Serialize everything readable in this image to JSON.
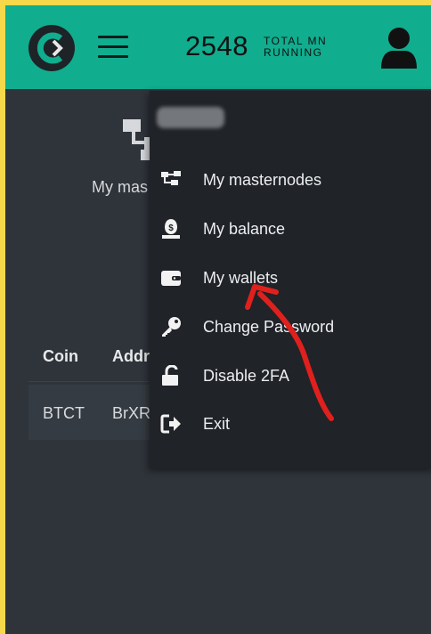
{
  "header": {
    "count": "2548",
    "count_label_line1": "TOTAL MN",
    "count_label_line2": "RUNNING",
    "logo_icon": "app-logo-icon",
    "menu_icon": "hamburger-icon",
    "account_icon": "user-icon"
  },
  "background": {
    "page_title": "My mas",
    "table": {
      "headers": [
        "Coin",
        "Addr"
      ],
      "rows": [
        [
          "BTCT",
          "BrXR"
        ]
      ]
    }
  },
  "dropdown": {
    "items": [
      {
        "label": "My masternodes",
        "icon": "network-nodes-icon"
      },
      {
        "label": "My balance",
        "icon": "money-bag-icon"
      },
      {
        "label": "My wallets",
        "icon": "wallet-icon"
      },
      {
        "label": "Change Password",
        "icon": "key-icon"
      },
      {
        "label": "Disable 2FA",
        "icon": "unlock-icon"
      },
      {
        "label": "Exit",
        "icon": "sign-out-icon"
      }
    ]
  },
  "colors": {
    "header_bg": "#10ad8e",
    "page_bg": "#2f343b",
    "menu_bg": "#202328",
    "annotation": "#e0201d",
    "frame": "#f5d94a"
  }
}
